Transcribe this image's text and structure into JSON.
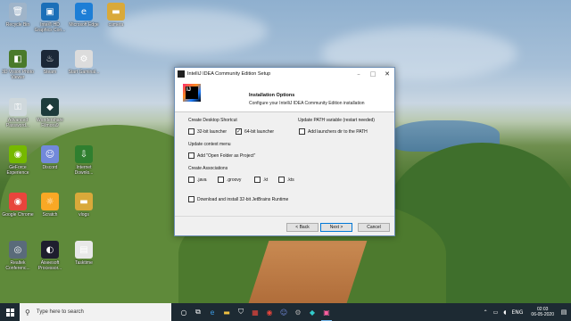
{
  "desktop_icons": [
    {
      "label": "Recycle Bin",
      "icon": "recycle-bin-icon",
      "color": "#9fb4c9",
      "glyph": "🗑"
    },
    {
      "label": "Intel® HD Graphics Con...",
      "icon": "intel-graphics-icon",
      "color": "#1b6fb8",
      "glyph": "▣"
    },
    {
      "label": "Microsoft Edge",
      "icon": "edge-icon",
      "color": "#1d7ed6",
      "glyph": "e"
    },
    {
      "label": "camera",
      "icon": "folder-icon",
      "color": "#d9a93a",
      "glyph": "▬"
    },
    {
      "label": "3D Vision Photo Viewer",
      "icon": "3d-vision-icon",
      "color": "#4a7a2a",
      "glyph": "◧"
    },
    {
      "label": "Steam",
      "icon": "steam-icon",
      "color": "#1b2838",
      "glyph": "♨"
    },
    {
      "label": "Start Gaminal...",
      "icon": "start-gaming-icon",
      "color": "#dcdcdc",
      "glyph": "⚙"
    },
    {
      "label": "Advanced Password...",
      "icon": "password-icon",
      "color": "#cfd8dc",
      "glyph": "⚿"
    },
    {
      "label": "Wondershare Filmora9",
      "icon": "filmora-icon",
      "color": "#1d3b3b",
      "glyph": "◆"
    },
    {
      "label": "GeForce Experience",
      "icon": "geforce-icon",
      "color": "#76b900",
      "glyph": "◉"
    },
    {
      "label": "Discord",
      "icon": "discord-icon",
      "color": "#7289da",
      "glyph": "☺"
    },
    {
      "label": "Internet Downlo...",
      "icon": "idm-icon",
      "color": "#2f7f2f",
      "glyph": "⇩"
    },
    {
      "label": "Google Chrome",
      "icon": "chrome-icon",
      "color": "#e8453c",
      "glyph": "◉"
    },
    {
      "label": "Scratch",
      "icon": "scratch-icon",
      "color": "#f9a825",
      "glyph": "☼"
    },
    {
      "label": "vlogs",
      "icon": "folder-icon",
      "color": "#d9a93a",
      "glyph": "▬"
    },
    {
      "label": "Realtek Conferenc...",
      "icon": "realtek-icon",
      "color": "#5a6b7a",
      "glyph": "◎"
    },
    {
      "label": "Aiseesoft Processor...",
      "icon": "aiseesoft-icon",
      "color": "#1e1e2e",
      "glyph": "◐"
    },
    {
      "label": "Tasktime",
      "icon": "file-icon",
      "color": "#e8e8e8",
      "glyph": "▤"
    }
  ],
  "dialog": {
    "title": "IntelliJ IDEA Community Edition Setup",
    "logo_text": "IJ",
    "header_title": "Installation Options",
    "header_subtitle": "Configure your IntelliJ IDEA Community Edition installation",
    "sections": {
      "shortcut": "Create Desktop Shortcut",
      "path": "Update PATH variable (restart needed)",
      "context": "Update context menu",
      "assoc": "Create Associations"
    },
    "checkboxes": {
      "bit32": {
        "label": "32-bit launcher",
        "checked": false
      },
      "bit64": {
        "label": "64-bit launcher",
        "checked": true
      },
      "add_path": {
        "label": "Add launchers dir to the PATH",
        "checked": false
      },
      "open_folder": {
        "label": "Add \"Open Folder as Project\"",
        "checked": false
      },
      "java": {
        "label": ".java",
        "checked": false
      },
      "groovy": {
        "label": ".groovy",
        "checked": false
      },
      "kt": {
        "label": ".kt",
        "checked": false
      },
      "kts": {
        "label": ".kts",
        "checked": false
      },
      "jbr": {
        "label": "Download and install 32-bit JetBrains Runtime",
        "checked": false
      }
    },
    "buttons": {
      "back": "< Back",
      "next": "Next >",
      "cancel": "Cancel"
    }
  },
  "taskbar": {
    "search_placeholder": "Type here to search",
    "language": "ENG",
    "time": "02:03",
    "date": "06-05-2020"
  }
}
